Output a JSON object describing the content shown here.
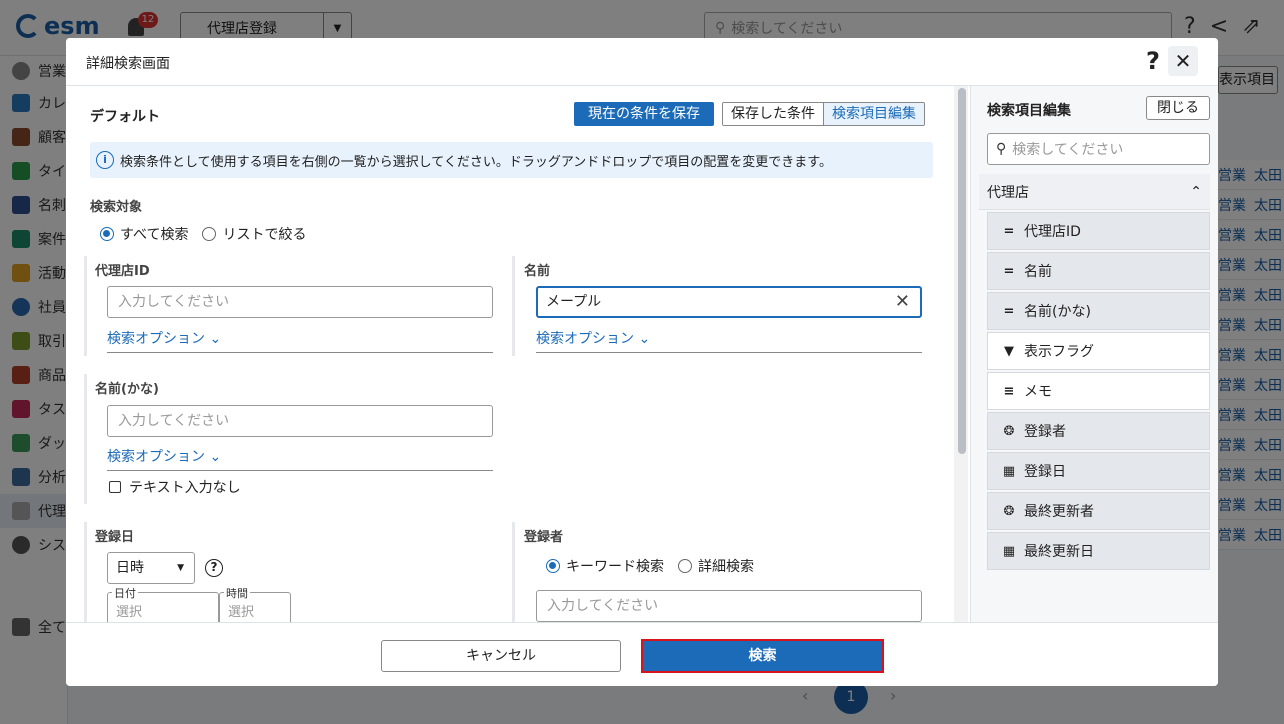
{
  "app": {
    "logo": "esm",
    "notification_count": "12",
    "page_select": "代理店登録",
    "search_placeholder": "検索してください",
    "user_label": "営業",
    "sidebar": [
      "カレ",
      "顧客",
      "タイ",
      "名刺",
      "案件",
      "活動",
      "社員",
      "取引",
      "商品",
      "タス",
      "ダッ",
      "分析",
      "代理",
      "シス"
    ],
    "all_label": "全て",
    "display_items_btn": "表示項目",
    "table_cells": [
      "営業",
      "太田"
    ],
    "pager_current": "1"
  },
  "modal": {
    "title": "詳細検索画面",
    "help": "?",
    "close": "✕",
    "preset_name": "デフォルト",
    "save_button": "現在の条件を保存",
    "saved_conditions": "保存した条件",
    "edit_fields": "検索項目編集",
    "info_text": "検索条件として使用する項目を右側の一覧から選択してください。ドラッグアンドドロップで項目の配置を変更できます。",
    "search_target": {
      "label": "検索対象",
      "options": [
        "すべて検索",
        "リストで絞る"
      ]
    },
    "fields": {
      "agency_id": {
        "label": "代理店ID",
        "placeholder": "入力してください",
        "option_link": "検索オプション"
      },
      "name": {
        "label": "名前",
        "value": "メープル",
        "option_link": "検索オプション"
      },
      "name_kana": {
        "label": "名前(かな)",
        "placeholder": "入力してください",
        "option_link": "検索オプション",
        "no_text": "テキスト入力なし"
      },
      "reg_date": {
        "label": "登録日",
        "select_value": "日時",
        "date_label": "日付",
        "time_label": "時間",
        "date_placeholder": "選択",
        "time_placeholder": "選択"
      },
      "registrant": {
        "label": "登録者",
        "options": [
          "キーワード検索",
          "詳細検索"
        ],
        "placeholder": "入力してください"
      }
    },
    "right_panel": {
      "title": "検索項目編集",
      "close": "閉じる",
      "search_placeholder": "検索してください",
      "section": "代理店",
      "items": [
        {
          "label": "代理店ID",
          "icon": "text-field-icon"
        },
        {
          "label": "名前",
          "icon": "text-field-icon"
        },
        {
          "label": "名前(かな)",
          "icon": "text-field-icon"
        },
        {
          "label": "表示フラグ",
          "icon": "dropdown-circle-icon"
        },
        {
          "label": "メモ",
          "icon": "multiline-text-icon"
        },
        {
          "label": "登録者",
          "icon": "user-tag-icon"
        },
        {
          "label": "登録日",
          "icon": "calendar-icon"
        },
        {
          "label": "最終更新者",
          "icon": "user-tag-icon"
        },
        {
          "label": "最終更新日",
          "icon": "calendar-icon"
        }
      ]
    },
    "footer": {
      "cancel": "キャンセル",
      "search": "検索"
    }
  },
  "colors": {
    "primary": "#1c6bb8",
    "highlight_border": "#d8141a",
    "badge": "#dd3333"
  }
}
